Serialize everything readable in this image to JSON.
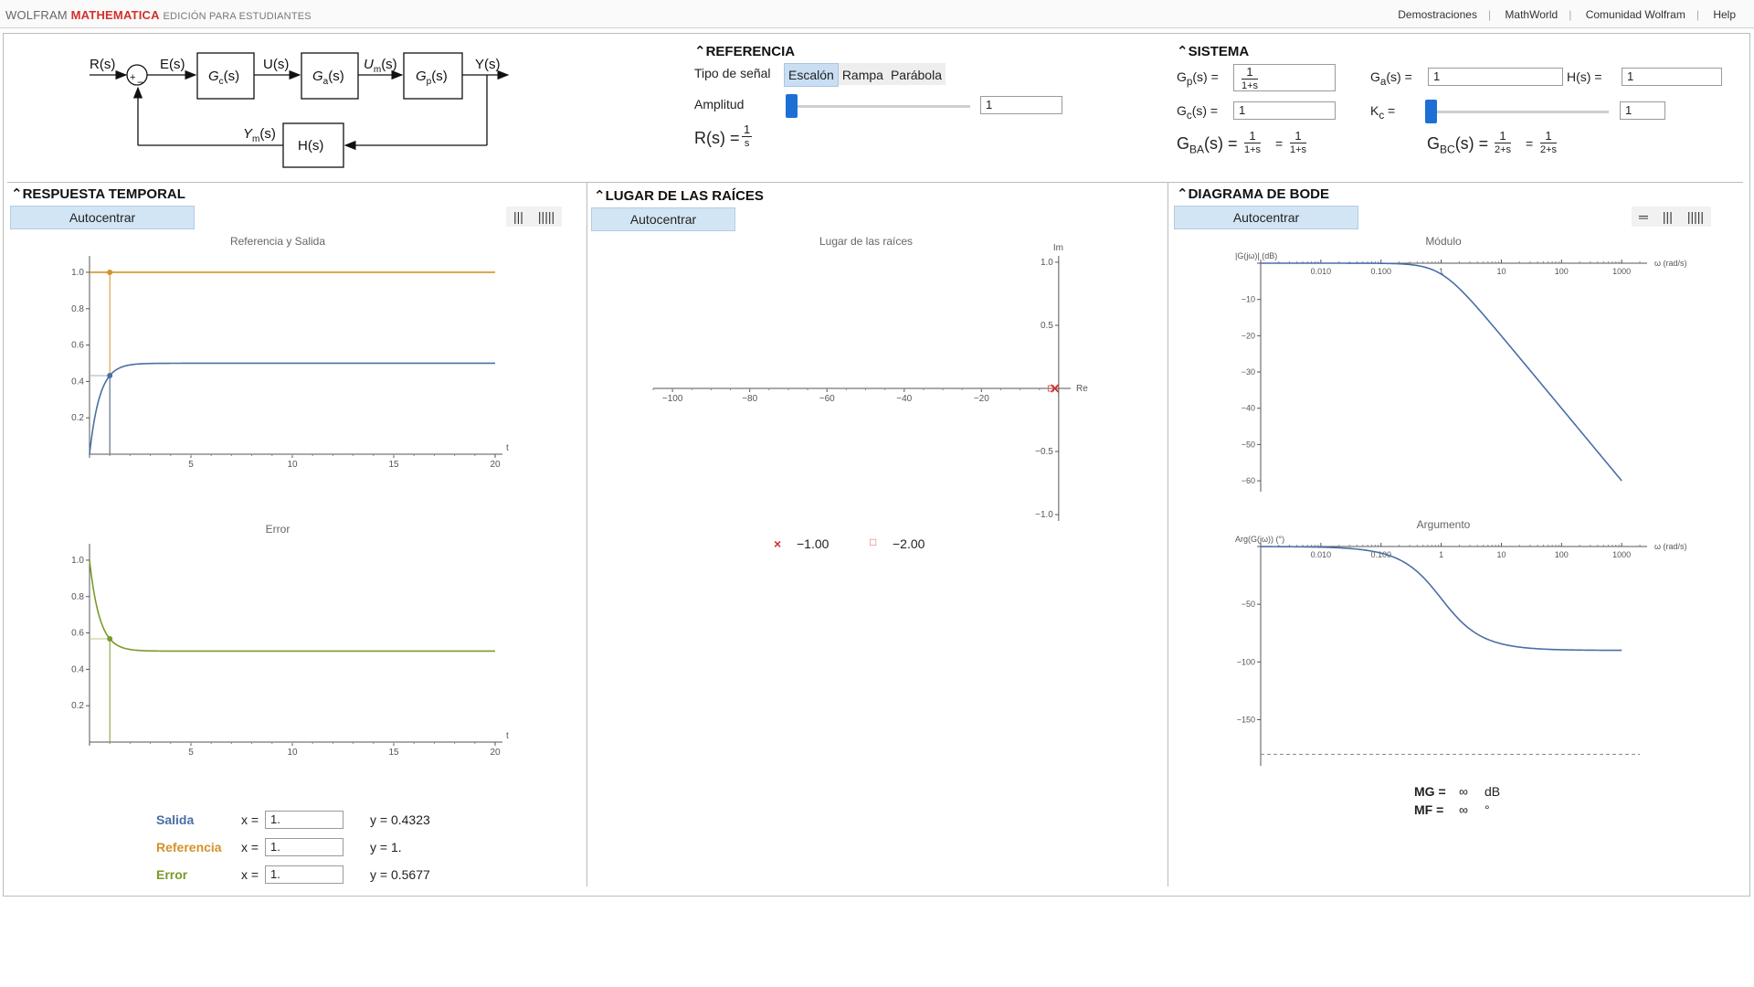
{
  "topbar": {
    "brand_wolfram": "WOLFRAM",
    "brand_mathematica": "MATHEMATICA",
    "brand_edition": "EDICIÓN PARA ESTUDIANTES",
    "links": [
      "Demostraciones",
      "MathWorld",
      "Comunidad Wolfram",
      "Help"
    ]
  },
  "diagram": {
    "r": "R(s)",
    "e": "E(s)",
    "gc": "G",
    "gc_sub": "c",
    "u": "U(s)",
    "ga": "G",
    "ga_sub": "a",
    "um": "U",
    "um_sub": "m",
    "gp": "G",
    "gp_sub": "p",
    "y": "Y(s)",
    "ym": "Y",
    "ym_sub": "m",
    "h": "H(s)",
    "s_suffix": "(s)",
    "plus": "+",
    "minus": "−"
  },
  "referencia": {
    "title": "REFERENCIA",
    "tipo_label": "Tipo de señal",
    "tipos": [
      "Escalón",
      "Rampa",
      "Parábola"
    ],
    "selected": "Escalón",
    "amplitud_label": "Amplitud",
    "amplitud_value": "1",
    "amplitud_fraction": 0,
    "rs_label": "R(s) =",
    "rs_num": "1",
    "rs_den": "s"
  },
  "sistema": {
    "title": "SISTEMA",
    "gp_label": "G",
    "gp_sub": "p",
    "gp_suffix": "(s) =",
    "gp_num": "1",
    "gp_den": "1+s",
    "ga_label": "G",
    "ga_sub": "a",
    "ga_suffix": "(s) =",
    "ga_value": "1",
    "h_label": "H(s) =",
    "h_value": "1",
    "gc_label": "G",
    "gc_sub": "c",
    "gc_suffix": "(s) =",
    "gc_value": "1",
    "kc_label": "K",
    "kc_sub": "c",
    "kc_suffix": " =",
    "kc_value": "1",
    "kc_fraction": 0,
    "gba_label": "G",
    "gba_sub": "BA",
    "gba_suffix": "(s) =",
    "gba_num1": "1",
    "gba_den1": "1+s",
    "gba_num2": "1",
    "gba_den2": "1+s",
    "gbc_label": "G",
    "gbc_sub": "BC",
    "gbc_suffix": "(s) =",
    "gbc_num1": "1",
    "gbc_den1": "2+s",
    "gbc_num2": "1",
    "gbc_den2": "2+s",
    "eq": "="
  },
  "respuesta": {
    "title": "RESPUESTA TEMPORAL",
    "autocentrar": "Autocentrar",
    "icons": [
      "|||",
      "|||||"
    ],
    "plot1_title": "Referencia y Salida",
    "plot2_title": "Error",
    "salida_label": "Salida",
    "salida_x": "1.",
    "salida_y": "y = 0.4323",
    "referencia_label": "Referencia",
    "referencia_x": "1.",
    "referencia_y": "y = 1.",
    "error_label": "Error",
    "error_x": "1.",
    "error_y": "y = 0.5677",
    "x_eq": "x ="
  },
  "lugar": {
    "title": "LUGAR DE LAS RAÍCES",
    "autocentrar": "Autocentrar",
    "plot_title": "Lugar de las raíces",
    "pole_symbol": "×",
    "pole_value": "−1.00",
    "cl_symbol": "□",
    "cl_value": "−2.00"
  },
  "bode": {
    "title": "DIAGRAMA DE BODE",
    "autocentrar": "Autocentrar",
    "icons": [
      "═",
      "|||",
      "|||||"
    ],
    "modulo_title": "Módulo",
    "argumento_title": "Argumento",
    "mg_label": "MG =",
    "mg_value": "∞",
    "mg_unit": "dB",
    "mf_label": "MF =",
    "mf_value": "∞",
    "mf_unit": "°"
  },
  "colors": {
    "salida": "#4a6fa5",
    "referencia": "#d4922a",
    "error": "#7a9a2a",
    "accent": "#1d6fd6",
    "brand": "#d3302b"
  },
  "chart_data": [
    {
      "type": "line",
      "title": "Referencia y Salida",
      "xlabel": "t",
      "xlim": [
        0,
        20
      ],
      "ylim": [
        0,
        1.05
      ],
      "xticks": [
        5,
        10,
        15,
        20
      ],
      "yticks": [
        0.2,
        0.4,
        0.6,
        0.8,
        1.0
      ],
      "series": [
        {
          "name": "Referencia",
          "x": [
            0,
            20
          ],
          "y": [
            1,
            1
          ]
        },
        {
          "name": "Salida",
          "function": "0.5*(1-exp(-2t))"
        }
      ],
      "marker": {
        "x": 1,
        "y_salida": 0.4323,
        "y_referencia": 1
      }
    },
    {
      "type": "line",
      "title": "Error",
      "xlabel": "t",
      "xlim": [
        0,
        20
      ],
      "ylim": [
        0,
        1.05
      ],
      "xticks": [
        5,
        10,
        15,
        20
      ],
      "yticks": [
        0.2,
        0.4,
        0.6,
        0.8,
        1.0
      ],
      "series": [
        {
          "name": "Error",
          "function": "0.5+0.5*exp(-2t)"
        }
      ],
      "marker": {
        "x": 1,
        "y": 0.5677
      }
    },
    {
      "type": "scatter",
      "title": "Lugar de las raíces",
      "xlabel": "Re",
      "ylabel": "Im",
      "xlim": [
        -105,
        5
      ],
      "ylim": [
        -1.05,
        1.05
      ],
      "xticks": [
        -100,
        -80,
        -60,
        -40,
        -20
      ],
      "yticks": [
        -1.0,
        -0.5,
        0.5,
        1.0
      ],
      "poles": [
        {
          "re": -1,
          "im": 0
        }
      ],
      "closed_loop_poles": [
        {
          "re": -2,
          "im": 0
        }
      ]
    },
    {
      "type": "line",
      "title": "Módulo",
      "xlabel": "ω (rad/s)",
      "ylabel": "|G(jω)| (dB)",
      "xscale": "log",
      "xlim": [
        0.001,
        2000
      ],
      "ylim": [
        -63,
        0
      ],
      "xticks": [
        0.01,
        0.1,
        1,
        10,
        100,
        1000
      ],
      "xticklabels": [
        "0.010",
        "0.100",
        "1",
        "10",
        "100",
        "1000"
      ],
      "yticks": [
        -10,
        -20,
        -30,
        -40,
        -50,
        -60
      ],
      "series": [
        {
          "function": "-10*log10(1+w^2)"
        }
      ]
    },
    {
      "type": "line",
      "title": "Argumento",
      "xlabel": "ω (rad/s)",
      "ylabel": "Arg(G(jω)) (°)",
      "xscale": "log",
      "xlim": [
        0.001,
        2000
      ],
      "ylim": [
        -190,
        0
      ],
      "xticks": [
        0.01,
        0.1,
        1,
        10,
        100,
        1000
      ],
      "xticklabels": [
        "0.010",
        "0.100",
        "1",
        "10",
        "100",
        "1000"
      ],
      "yticks": [
        -50,
        -100,
        -150
      ],
      "series": [
        {
          "function": "-atan(w)"
        }
      ],
      "reference_line": -180
    }
  ]
}
